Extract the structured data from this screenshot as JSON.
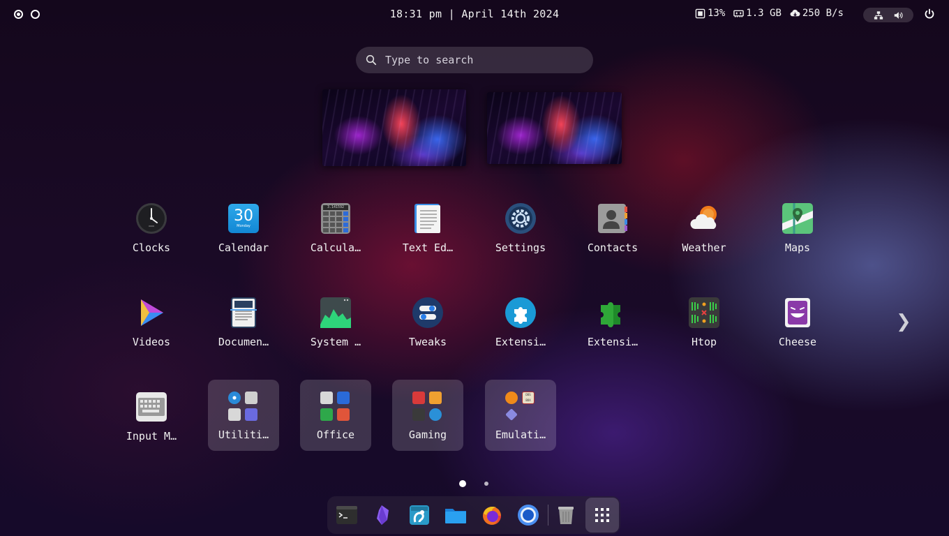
{
  "topbar": {
    "datetime": "18:31 pm | April 14th 2024",
    "cpu": "13%",
    "memory": "1.3 GB",
    "network": "250 B/s"
  },
  "search": {
    "placeholder": "Type to search"
  },
  "apps": [
    {
      "label": "Clocks",
      "icon": "clock-icon"
    },
    {
      "label": "Calendar",
      "icon": "calendar-icon",
      "day": "30",
      "weekday": "Monday"
    },
    {
      "label": "Calcula…",
      "icon": "calculator-icon",
      "display": "3.141592"
    },
    {
      "label": "Text Ed…",
      "icon": "text-editor-icon"
    },
    {
      "label": "Settings",
      "icon": "settings-icon"
    },
    {
      "label": "Contacts",
      "icon": "contacts-icon"
    },
    {
      "label": "Weather",
      "icon": "weather-icon"
    },
    {
      "label": "Maps",
      "icon": "maps-icon"
    },
    {
      "label": "Videos",
      "icon": "videos-icon"
    },
    {
      "label": "Documen…",
      "icon": "document-scanner-icon"
    },
    {
      "label": "System …",
      "icon": "system-monitor-icon"
    },
    {
      "label": "Tweaks",
      "icon": "tweaks-icon"
    },
    {
      "label": "Extensi…",
      "icon": "extensions-icon"
    },
    {
      "label": "Extensi…",
      "icon": "extension-manager-icon"
    },
    {
      "label": "Htop",
      "icon": "htop-icon"
    },
    {
      "label": "Cheese",
      "icon": "cheese-icon"
    },
    {
      "label": "Input M…",
      "icon": "keyboard-icon"
    }
  ],
  "folders": [
    {
      "label": "Utiliti…",
      "icon": "utilities-folder-icon"
    },
    {
      "label": "Office",
      "icon": "office-folder-icon"
    },
    {
      "label": "Gaming",
      "icon": "gaming-folder-icon"
    },
    {
      "label": "Emulati…",
      "icon": "emulation-folder-icon",
      "dosbox_text": "DOS BOX"
    }
  ],
  "pages": {
    "count": 2,
    "current": 1
  },
  "dock": [
    {
      "name": "terminal-icon"
    },
    {
      "name": "obsidian-icon"
    },
    {
      "name": "gimp-icon"
    },
    {
      "name": "files-icon"
    },
    {
      "name": "firefox-icon"
    },
    {
      "name": "chromium-icon"
    },
    {
      "name": "trash-icon"
    },
    {
      "name": "show-apps-icon"
    }
  ],
  "colors": {
    "accent_blue": "#2aa0e8",
    "folder_bg": "rgba(255,255,255,0.17)"
  }
}
